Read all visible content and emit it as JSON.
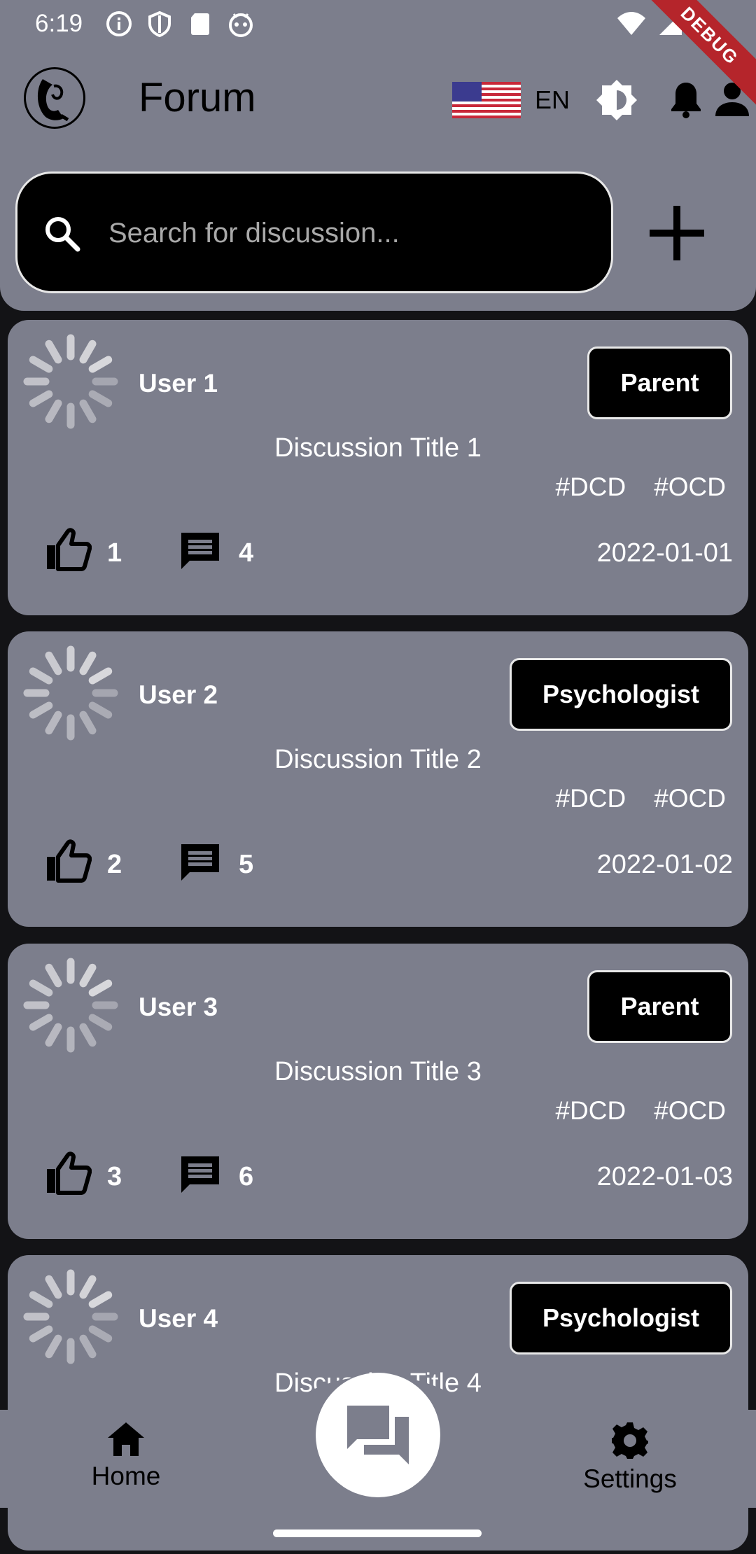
{
  "status_bar": {
    "time": "6:19",
    "left_icons": [
      "info-icon",
      "shield-icon",
      "sd-card-icon",
      "android-icon"
    ],
    "right_icons": [
      "wifi-icon",
      "signal-icon",
      "battery-icon"
    ]
  },
  "debug_banner": "DEBUG",
  "header": {
    "title": "Forum",
    "language": "EN",
    "language_flag": "us-flag-icon"
  },
  "search": {
    "placeholder": "Search for discussion...",
    "value": ""
  },
  "discussions": [
    {
      "user": "User 1",
      "role": "Parent",
      "title": "Discussion Title 1",
      "tags": [
        "#DCD",
        "#OCD"
      ],
      "likes": "1",
      "comments": "4",
      "date": "2022-01-01"
    },
    {
      "user": "User 2",
      "role": "Psychologist",
      "title": "Discussion Title 2",
      "tags": [
        "#DCD",
        "#OCD"
      ],
      "likes": "2",
      "comments": "5",
      "date": "2022-01-02"
    },
    {
      "user": "User 3",
      "role": "Parent",
      "title": "Discussion Title 3",
      "tags": [
        "#DCD",
        "#OCD"
      ],
      "likes": "3",
      "comments": "6",
      "date": "2022-01-03"
    },
    {
      "user": "User 4",
      "role": "Psychologist",
      "title": "Discussion Title 4"
    }
  ],
  "bottom_nav": {
    "home_label": "Home",
    "settings_label": "Settings",
    "fab_icon": "forum-icon"
  },
  "colors": {
    "surface": "#7c7e8c",
    "background": "#131316",
    "badge": "#000000",
    "ribbon": "#b5252b"
  }
}
